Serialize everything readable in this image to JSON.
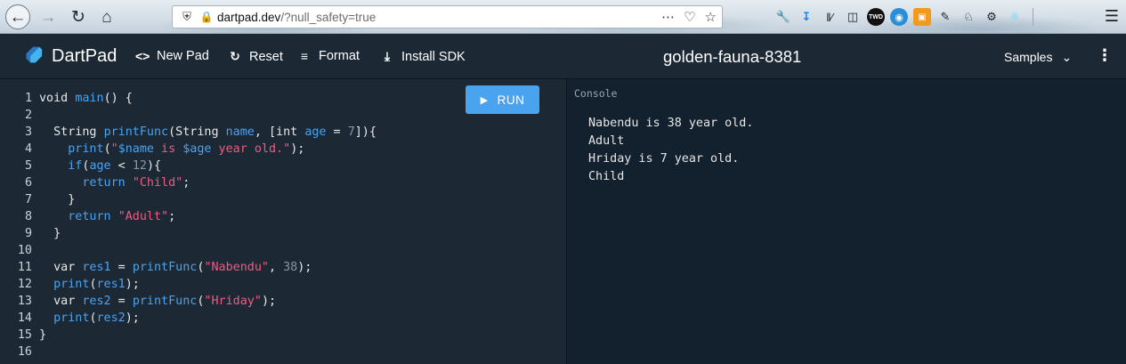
{
  "browser": {
    "url_host": "dartpad.dev",
    "url_rest": "/?null_safety=true",
    "icons": [
      "back-icon",
      "forward-icon",
      "reload-icon",
      "home-icon",
      "shield-icon",
      "lock-icon",
      "page-actions-icon",
      "pocket-icon",
      "bookmark-star-icon",
      "wrench-icon",
      "download-icon",
      "library-icon",
      "reader-icon",
      "twd-icon",
      "globe-icon",
      "screenshot-icon",
      "notes-icon",
      "puzzle-icon",
      "extension-icon",
      "react-icon",
      "menu-icon"
    ]
  },
  "app": {
    "brand": "DartPad",
    "toolbar": {
      "new_pad": "New Pad",
      "reset": "Reset",
      "format": "Format",
      "install_sdk": "Install SDK"
    },
    "title": "golden-fauna-8381",
    "samples": "Samples",
    "run_label": "RUN",
    "colors": {
      "background": "#1c2834",
      "console_bg": "#13202d",
      "run_button": "#4aa3ef",
      "string": "#ef5b82",
      "identifier": "#4aa3f0"
    }
  },
  "editor": {
    "lines": [
      {
        "n": "1",
        "text": "void main() {"
      },
      {
        "n": "2",
        "text": ""
      },
      {
        "n": "3",
        "text": "  String printFunc(String name, [int age = 7]){"
      },
      {
        "n": "4",
        "text": "    print(\"$name is $age year old.\");"
      },
      {
        "n": "5",
        "text": "    if(age < 12){"
      },
      {
        "n": "6",
        "text": "      return \"Child\";"
      },
      {
        "n": "7",
        "text": "    }"
      },
      {
        "n": "8",
        "text": "    return \"Adult\";"
      },
      {
        "n": "9",
        "text": "  }"
      },
      {
        "n": "10",
        "text": ""
      },
      {
        "n": "11",
        "text": "  var res1 = printFunc(\"Nabendu\", 38);"
      },
      {
        "n": "12",
        "text": "  print(res1);"
      },
      {
        "n": "13",
        "text": "  var res2 = printFunc(\"Hriday\");"
      },
      {
        "n": "14",
        "text": "  print(res2);"
      },
      {
        "n": "15",
        "text": "}"
      },
      {
        "n": "16",
        "text": ""
      }
    ]
  },
  "console": {
    "title": "Console",
    "output": [
      "Nabendu is 38 year old.",
      "Adult",
      "Hriday is 7 year old.",
      "Child"
    ]
  }
}
